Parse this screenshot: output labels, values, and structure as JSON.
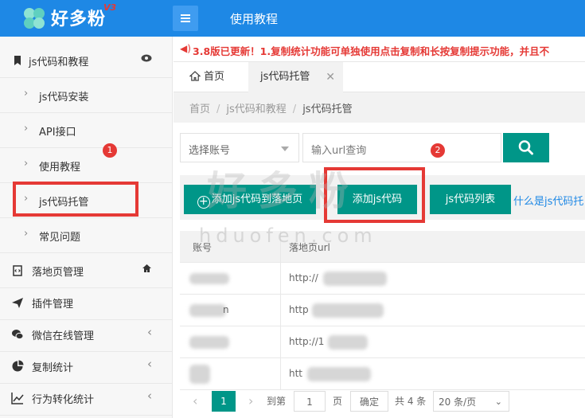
{
  "header": {
    "logo_text": "好多粉",
    "logo_version": "V3",
    "title": "使用教程"
  },
  "sidebar": {
    "items": [
      {
        "label": "js代码和教程",
        "icon": "bookmark-icon",
        "right_icon": "eye-icon"
      },
      {
        "label": "js代码安装"
      },
      {
        "label": "API接口"
      },
      {
        "label": "使用教程"
      },
      {
        "label": "js代码托管"
      },
      {
        "label": "常见问题"
      },
      {
        "label": "落地页管理",
        "icon": "code-file-icon",
        "right_icon": "home-icon"
      },
      {
        "label": "插件管理",
        "icon": "send-icon"
      },
      {
        "label": "微信在线管理",
        "icon": "wechat-icon",
        "right_icon": "chevron-left-icon"
      },
      {
        "label": "复制统计",
        "icon": "pie-chart-icon",
        "right_icon": "chevron-left-icon"
      },
      {
        "label": "行为转化统计",
        "icon": "line-chart-icon",
        "right_icon": "chevron-left-icon"
      }
    ]
  },
  "annotations": {
    "one": "1",
    "two": "2"
  },
  "notice": "3.8版已更新！1.复制统计功能可单独使用点击复制和长按复制提示功能，并且不",
  "tabs": {
    "home": "首页",
    "active": "js代码托管"
  },
  "breadcrumb": {
    "a": "首页",
    "b": "js代码和教程",
    "c": "js代码托管"
  },
  "filters": {
    "account_select": "选择账号",
    "url_placeholder": "输入url查询"
  },
  "buttons": {
    "add_to_landing": "添加js代码到落地页",
    "add_js": "添加js代码",
    "js_list": "js代码列表",
    "help_link": "什么是js代码托"
  },
  "table": {
    "headers": [
      "账号",
      "落地页url"
    ],
    "rows": [
      {
        "account": "",
        "url": "http://"
      },
      {
        "account": "n",
        "url": "http"
      },
      {
        "account": "",
        "url": "http://1"
      },
      {
        "account": "",
        "url": "htt"
      }
    ]
  },
  "pager": {
    "current": "1",
    "goto_label": "到第",
    "goto_value": "1",
    "page_unit": "页",
    "confirm": "确定",
    "total": "共 4 条",
    "page_size": "20 条/页"
  },
  "watermark": {
    "cn": "好多粉",
    "en": "hduofen.com"
  },
  "colors": {
    "header": "#1e88e5",
    "primary": "#009688",
    "alert": "#e53935"
  }
}
